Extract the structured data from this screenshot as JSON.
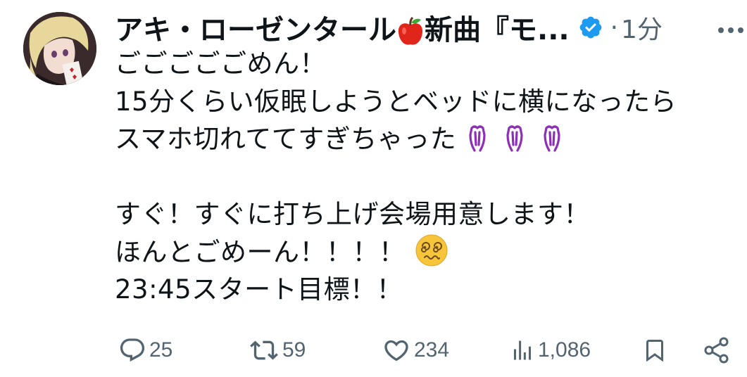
{
  "post": {
    "author": {
      "display_name_prefix": "アキ・ローゼンタール",
      "display_name_suffix": "新曲『モ...",
      "verified": true
    },
    "separator": "·",
    "time": "1分",
    "text_lines": {
      "l1": "ごごごごごめん！",
      "l2": "15分くらい仮眠しようとベッドに横になったら",
      "l3": "スマホ切れててすぎちゃった",
      "l5": "すぐ！すぐに打ち上げ会場用意します！",
      "l6": "ほんとごめーん！！！！",
      "l7": "23:45スタート目標！！"
    },
    "emojis": {
      "name_emoji": "apple-icon",
      "l3_emoji": "pleading-hands-icon",
      "l6_emoji": "dizzy-face-icon"
    }
  },
  "actions": {
    "replies": "25",
    "reposts": "59",
    "likes": "234",
    "views": "1,086"
  },
  "colors": {
    "text": "#0f1419",
    "muted": "#536471",
    "verified": "#1d9bf0",
    "apple": "#e0251b",
    "emoji_purple": "#8e2fb8",
    "emoji_yellow": "#f7c53a"
  }
}
